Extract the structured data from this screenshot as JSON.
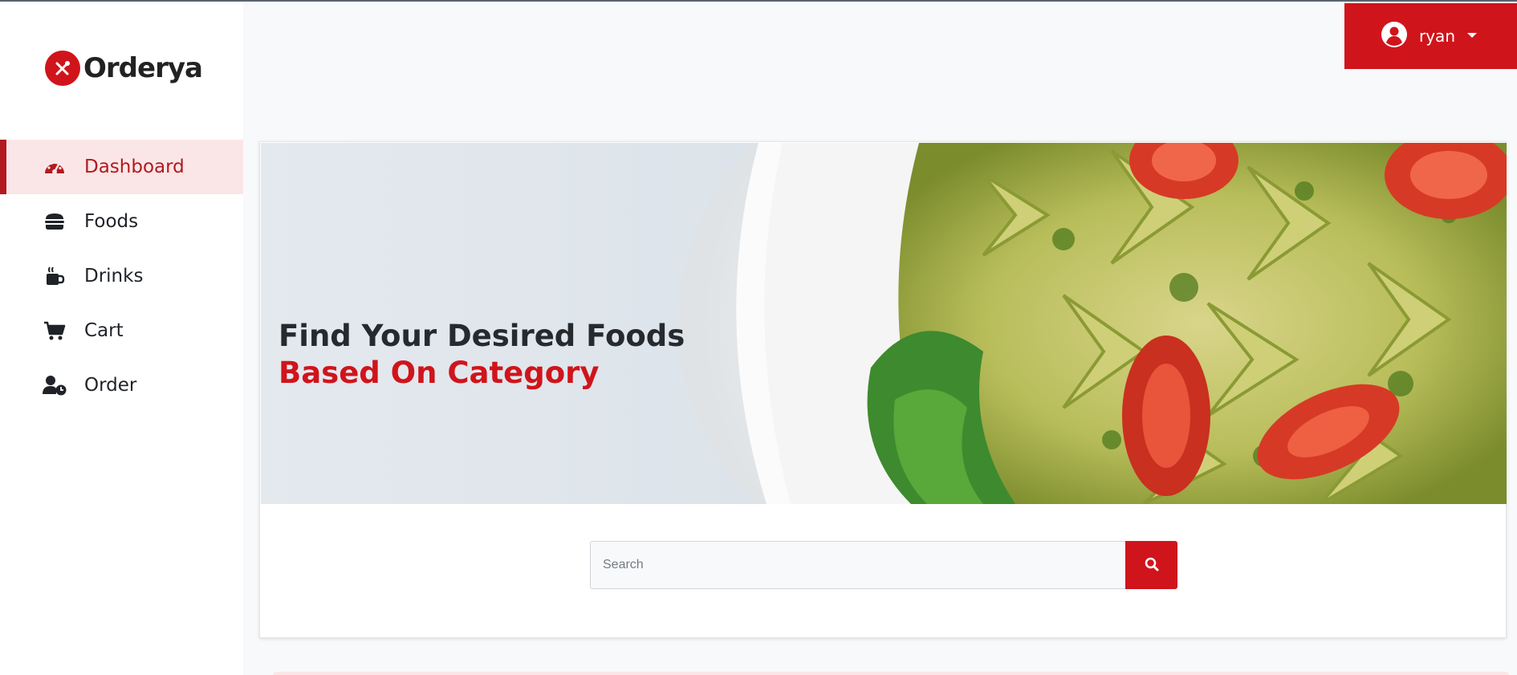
{
  "brand": {
    "name": "Orderya",
    "logo_icon": "fork-knife-icon",
    "accent": "#d0141b"
  },
  "user": {
    "name": "ryan",
    "icon": "user-circle-icon",
    "caret": "caret-down-icon"
  },
  "sidebar": {
    "items": [
      {
        "label": "Dashboard",
        "icon": "gauge-icon",
        "active": true
      },
      {
        "label": "Foods",
        "icon": "burger-icon",
        "active": false
      },
      {
        "label": "Drinks",
        "icon": "mug-icon",
        "active": false
      },
      {
        "label": "Cart",
        "icon": "cart-icon",
        "active": false
      },
      {
        "label": "Order",
        "icon": "user-clock-icon",
        "active": false
      }
    ]
  },
  "hero": {
    "line1": "Find Your Desired Foods",
    "line2": "Based On Category",
    "image": "pasta-salad-image"
  },
  "search": {
    "placeholder": "Search",
    "value": "",
    "button_icon": "search-icon"
  }
}
